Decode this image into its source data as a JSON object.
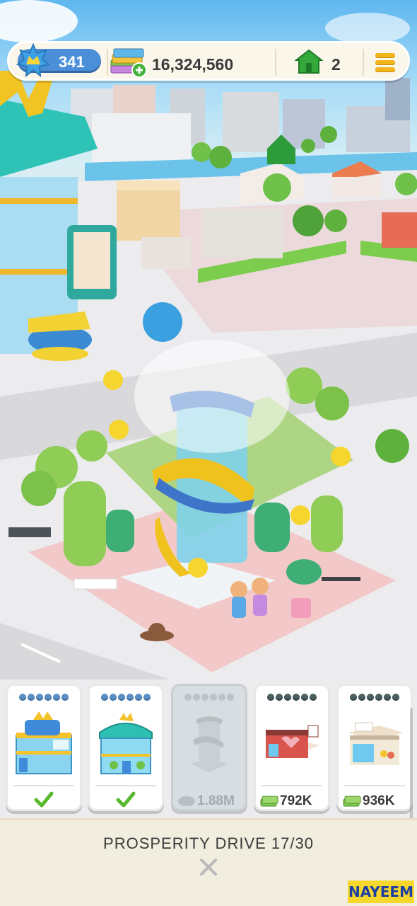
{
  "hud": {
    "level": "341",
    "cash": "16,324,560",
    "houses": "2",
    "icons": {
      "level": "star-badge-icon",
      "cash": "cash-stack-add-icon",
      "houses": "green-house-icon",
      "menu": "hamburger-menu-icon"
    }
  },
  "cards": [
    {
      "name": "shopping-mall",
      "dots": 6,
      "status": "built",
      "icon": "checkmark-icon"
    },
    {
      "name": "glass-building",
      "dots": 6,
      "status": "built",
      "icon": "checkmark-icon"
    },
    {
      "name": "fountain",
      "dots": 6,
      "status": "locked",
      "price": "1.88M"
    },
    {
      "name": "cafe-shop",
      "dots": 6,
      "status": "available",
      "price": "792K"
    },
    {
      "name": "market-stall",
      "dots": 6,
      "status": "available",
      "price": "936K"
    }
  ],
  "panel": {
    "title": "PROSPERITY DRIVE 17/30",
    "close_icon": "close-x-icon"
  },
  "watermark": "NAYEEM",
  "colors": {
    "hud_bg": "#fbf6ea",
    "level_pill": "#4a8fd8",
    "accent_yellow": "#f2b51c",
    "check_green": "#58b82e",
    "panel_bg": "#f2eedf"
  }
}
